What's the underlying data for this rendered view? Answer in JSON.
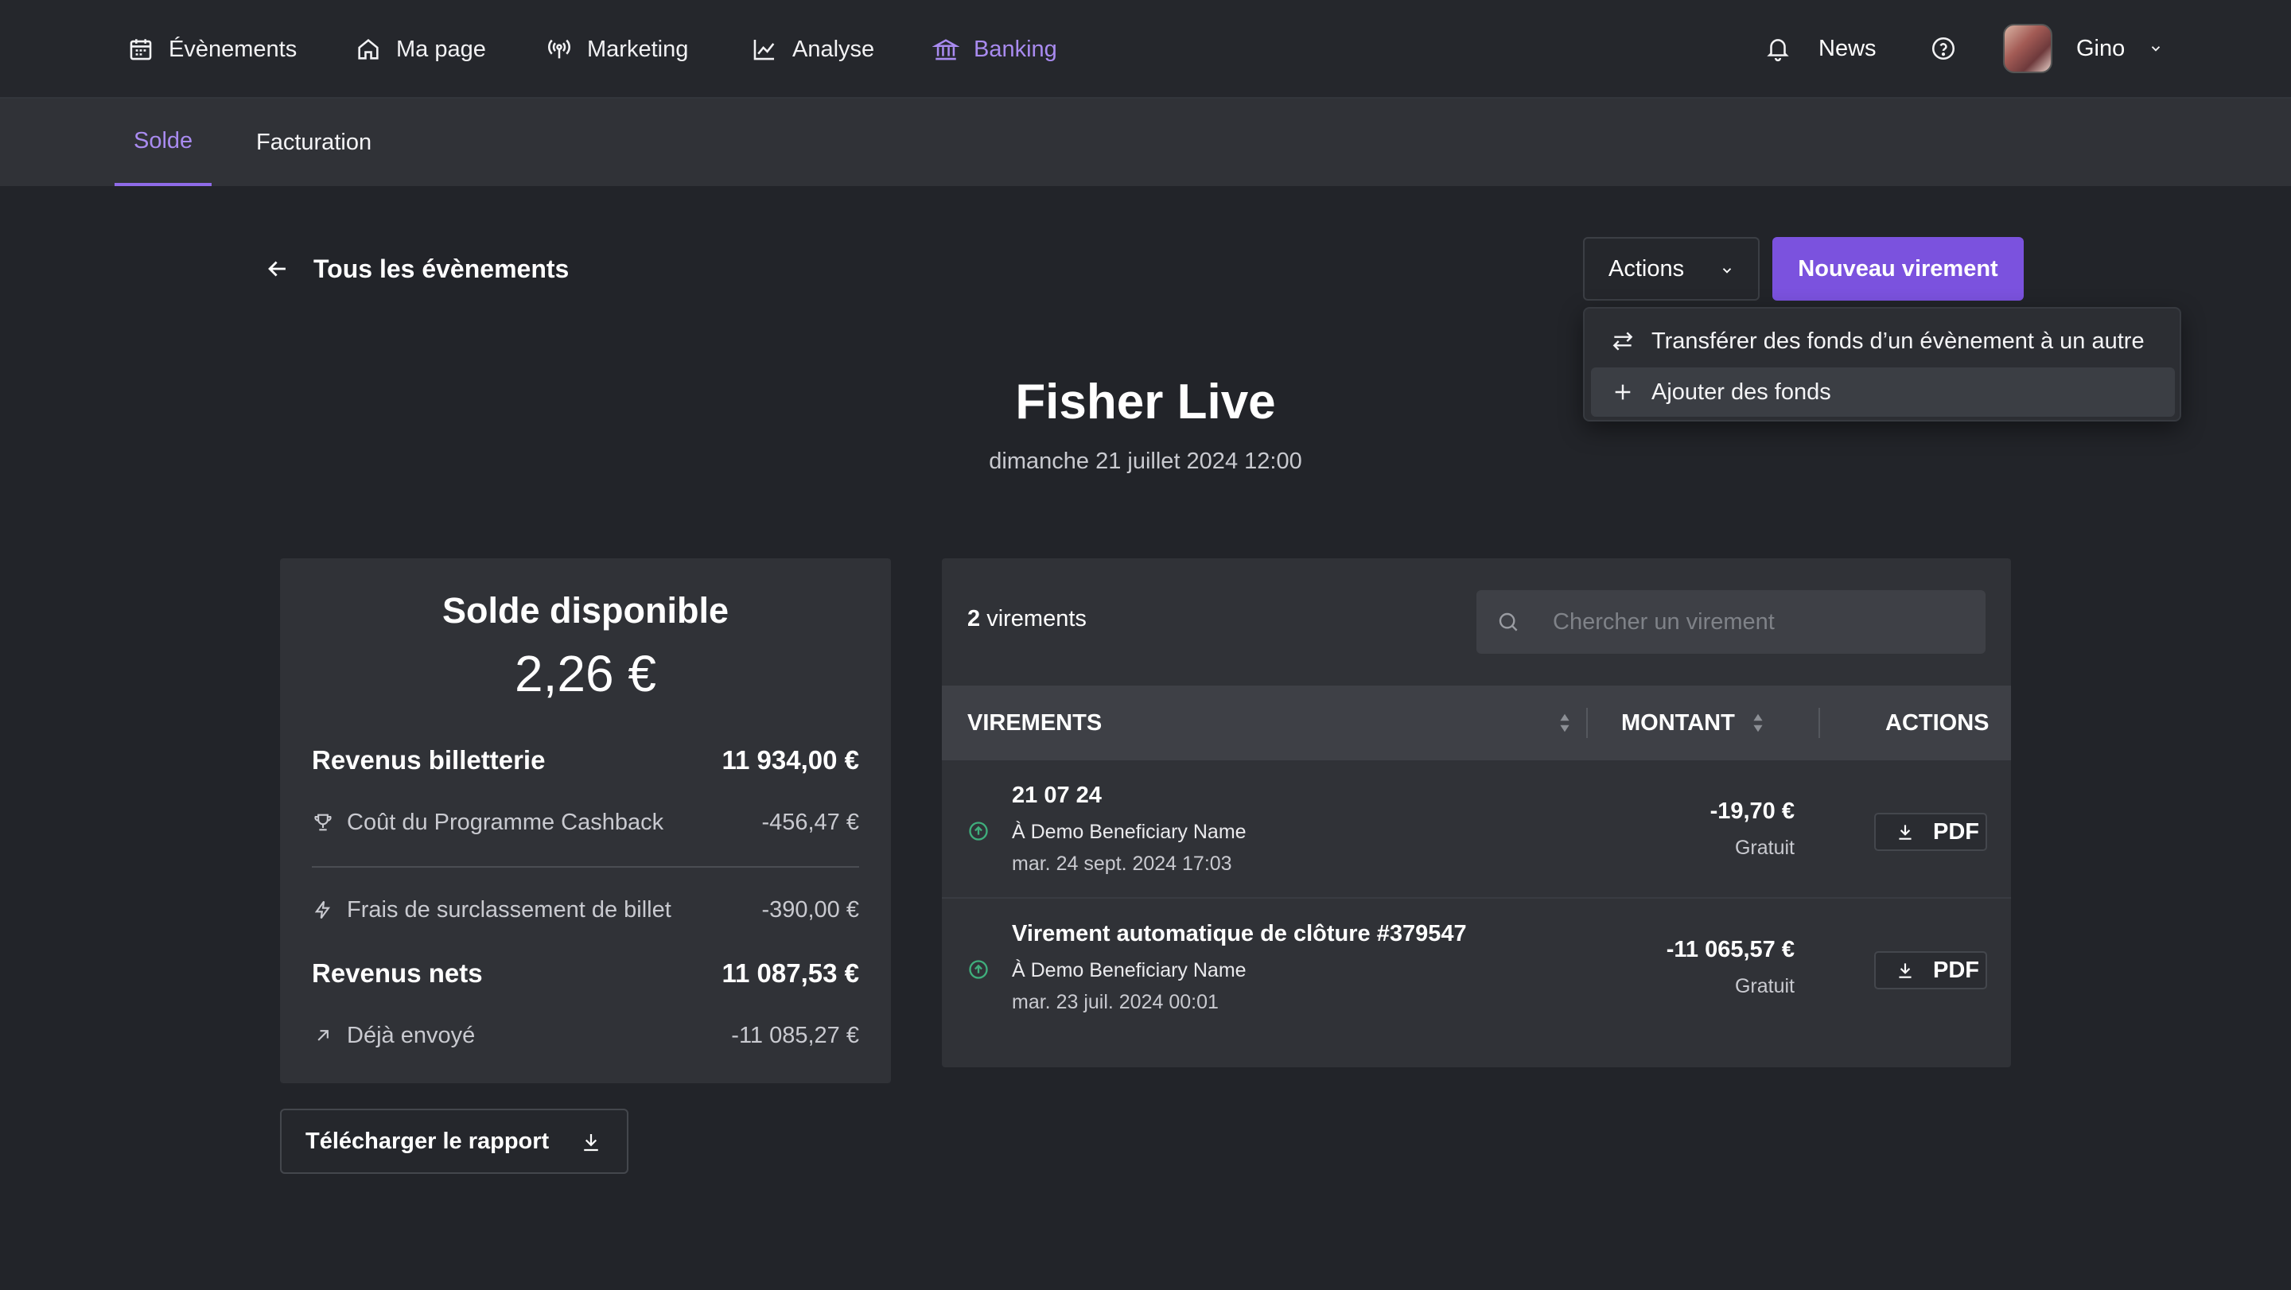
{
  "nav": {
    "items": [
      {
        "label": "Évènements",
        "icon": "calendar-icon"
      },
      {
        "label": "Ma page",
        "icon": "home-icon"
      },
      {
        "label": "Marketing",
        "icon": "broadcast-icon"
      },
      {
        "label": "Analyse",
        "icon": "chart-line-icon"
      },
      {
        "label": "Banking",
        "icon": "bank-icon"
      }
    ],
    "active": "Banking",
    "news_label": "News",
    "user_name": "Gino",
    "accent_color": "#a98bf0"
  },
  "subnav": {
    "tabs": [
      {
        "label": "Solde"
      },
      {
        "label": "Facturation"
      }
    ],
    "active": "Solde"
  },
  "back_label": "Tous les évènements",
  "actions": {
    "label": "Actions",
    "primary_label": "Nouveau virement",
    "primary_color": "#7b52de",
    "menu": [
      {
        "label": "Transférer des fonds d’un évènement à un autre",
        "icon": "transfer-icon"
      },
      {
        "label": "Ajouter des fonds",
        "icon": "plus-icon"
      }
    ]
  },
  "event": {
    "title": "Fisher Live",
    "date": "dimanche 21 juillet 2024 12:00"
  },
  "balance": {
    "title": "Solde disponible",
    "amount": "2,26 €",
    "rows": [
      {
        "label": "Revenus billetterie",
        "value": "11 934,00 €"
      },
      {
        "label": "Coût du Programme Cashback",
        "value": "-456,47 €",
        "icon": "trophy-icon"
      },
      {
        "label": "Frais de surclassement de billet",
        "value": "-390,00 €",
        "icon": "lightning-icon"
      },
      {
        "label": "Revenus nets",
        "value": "11 087,53 €"
      },
      {
        "label": "Déjà envoyé",
        "value": "-11 085,27 €",
        "icon": "arrow-up-right-icon"
      }
    ],
    "download_label": "Télécharger le rapport"
  },
  "transfers": {
    "count": "2",
    "count_label": "virements",
    "search_placeholder": "Chercher un virement",
    "columns": [
      "VIREMENTS",
      "MONTANT",
      "ACTIONS"
    ],
    "rows": [
      {
        "name": "21 07 24",
        "beneficiary": "À Demo Beneficiary Name",
        "date": "mar. 24 sept. 2024 17:03",
        "amount": "-19,70 €",
        "fee": "Gratuit",
        "action": "PDF"
      },
      {
        "name": "Virement automatique de clôture #379547",
        "beneficiary": "À Demo Beneficiary Name",
        "date": "mar. 23 juil. 2024 00:01",
        "amount": "-11 065,57 €",
        "fee": "Gratuit",
        "action": "PDF"
      }
    ],
    "status_color": "#3fae7c"
  }
}
